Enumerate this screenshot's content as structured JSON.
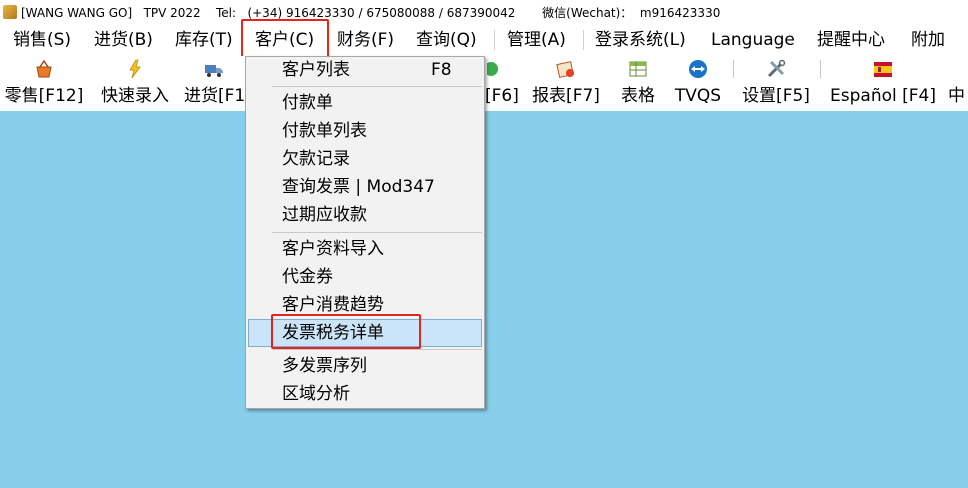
{
  "titlebar": {
    "text": "[WANG WANG GO]   TPV 2022    Tel:   (+34) 916423330 / 675080088 / 687390042       微信(Wechat)：  m916423330"
  },
  "menubar": {
    "items": [
      "销售(S)",
      "进货(B)",
      "库存(T)",
      "客户(C)",
      "财务(F)",
      "查询(Q)",
      "管理(A)",
      "登录系统(L)",
      "Language",
      "提醒中心",
      "附加"
    ]
  },
  "toolbar": {
    "items": [
      "零售[F12]",
      "快速录入",
      "进货[F1",
      "[F6]",
      "报表[F7]",
      "表格",
      "TVQS",
      "设置[F5]",
      "Español [F4]",
      "中"
    ]
  },
  "dropdown": {
    "items": [
      {
        "label": "客户列表",
        "shortcut": "F8"
      },
      {
        "label": "付款单"
      },
      {
        "label": "付款单列表"
      },
      {
        "label": "欠款记录"
      },
      {
        "label": "查询发票 | Mod347"
      },
      {
        "label": "过期应收款"
      },
      {
        "label": "客户资料导入"
      },
      {
        "label": "代金券"
      },
      {
        "label": "客户消费趋势"
      },
      {
        "label": "发票税务详单"
      },
      {
        "label": "多发票序列"
      },
      {
        "label": "区域分析"
      }
    ]
  },
  "colors": {
    "background": "#87CEEB",
    "highlight_box": "#e8231a",
    "selected_item": "#cce4f7"
  }
}
